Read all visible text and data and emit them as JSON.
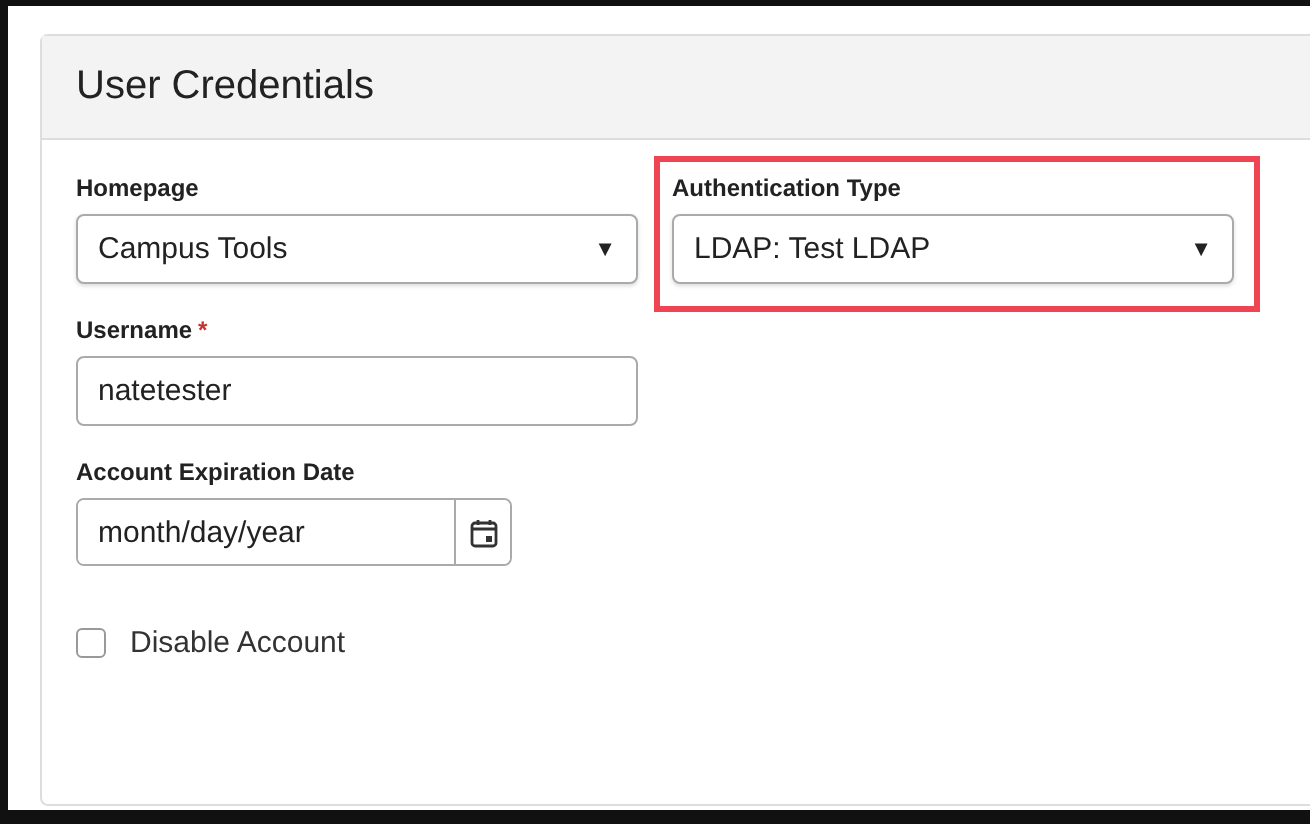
{
  "panel": {
    "title": "User Credentials"
  },
  "fields": [
    {
      "kind": "select",
      "label": "Homepage",
      "value": "Campus Tools",
      "arrow": "▼"
    },
    {
      "kind": "select",
      "label": "Authentication Type",
      "value": "LDAP: Test LDAP",
      "arrow": "▼",
      "highlighted": true
    },
    {
      "kind": "text",
      "label": "Username",
      "required_mark": "*",
      "value": "natetester"
    },
    {
      "kind": "date",
      "label": "Account Expiration Date",
      "placeholder": "month/day/year"
    },
    {
      "kind": "checkbox",
      "label": "Disable Account",
      "checked": false
    }
  ]
}
